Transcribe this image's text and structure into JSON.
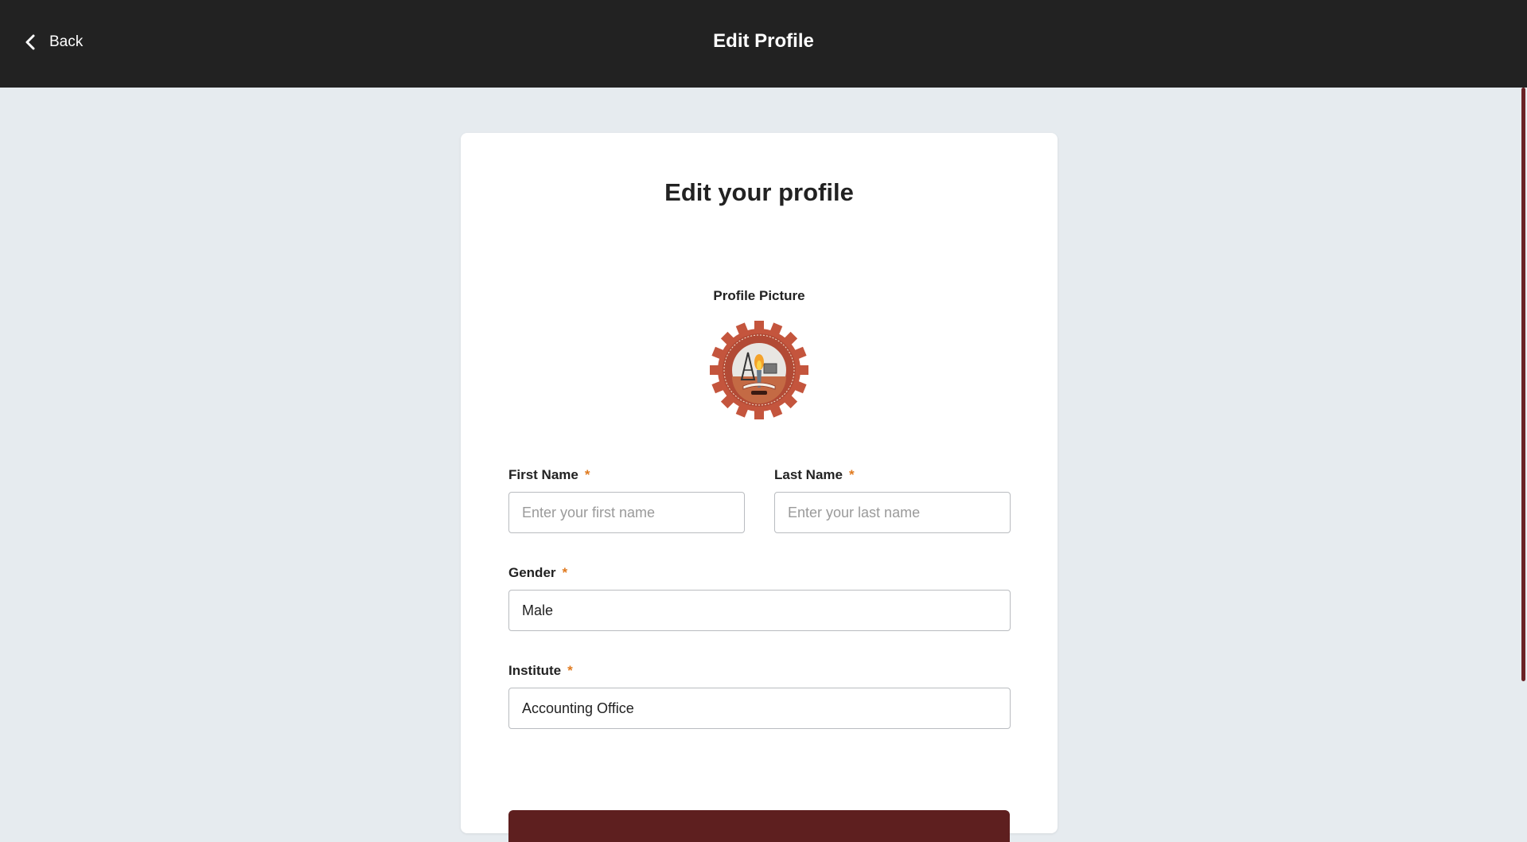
{
  "header": {
    "back_label": "Back",
    "title": "Edit Profile"
  },
  "card": {
    "title": "Edit your profile",
    "profile_picture_label": "Profile Picture"
  },
  "form": {
    "first_name": {
      "label": "First Name",
      "required": "*",
      "value": "",
      "placeholder": "Enter your first name"
    },
    "last_name": {
      "label": "Last Name",
      "required": "*",
      "value": "",
      "placeholder": "Enter your last name"
    },
    "gender": {
      "label": "Gender",
      "required": "*",
      "value": "Male"
    },
    "institute": {
      "label": "Institute",
      "required": "*",
      "value": "Accounting Office"
    }
  },
  "colors": {
    "header_bg": "#222222",
    "page_bg": "#e6ebef",
    "accent": "#5e1f1f",
    "required_star": "#e07a1f"
  },
  "icons": {
    "back": "chevron-left-icon",
    "avatar": "college-seal-logo"
  }
}
